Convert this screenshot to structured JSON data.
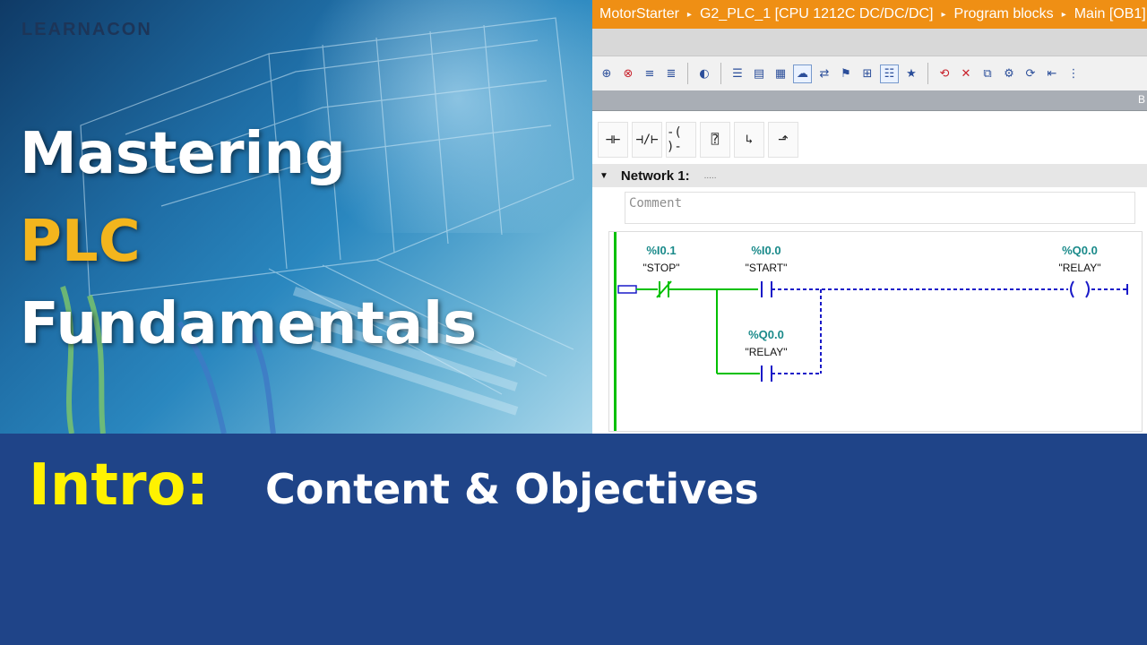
{
  "brand": "LEARNACON",
  "title": {
    "line1": "Mastering",
    "line2": "PLC",
    "line3": "Fundamentals"
  },
  "banner": {
    "highlight": "Intro:",
    "subtitle": "Content & Objectives"
  },
  "tia": {
    "breadcrumb": [
      "MotorStarter",
      "G2_PLC_1 [CPU 1212C DC/DC/DC]",
      "Program blocks",
      "Main [OB1]"
    ],
    "breadcrumb_separator": "▸",
    "side_letter": "B",
    "network_title": "Network 1:",
    "network_dots": ".....",
    "comment_placeholder": "Comment",
    "contacts": {
      "stop": {
        "address": "%I0.1",
        "tag": "\"STOP\"",
        "type": "normally-closed"
      },
      "start": {
        "address": "%I0.0",
        "tag": "\"START\"",
        "type": "normally-open"
      },
      "relay_latch": {
        "address": "%Q0.0",
        "tag": "\"RELAY\"",
        "type": "normally-open"
      },
      "relay_coil": {
        "address": "%Q0.0",
        "tag": "\"RELAY\"",
        "type": "coil"
      }
    },
    "ladder_tool_icons": [
      "nc-contact-icon",
      "no-contact-icon",
      "coil-icon",
      "empty-box-icon",
      "open-branch-icon",
      "close-branch-icon"
    ]
  },
  "colors": {
    "accent_orange": "#ef8f14",
    "title_yellow": "#f3b51d",
    "intro_yellow": "#fff200",
    "banner_blue": "#1f4488",
    "ladder_green": "#00c000",
    "ladder_blue": "#1a1ac8",
    "address_teal": "#1a8a8a"
  }
}
